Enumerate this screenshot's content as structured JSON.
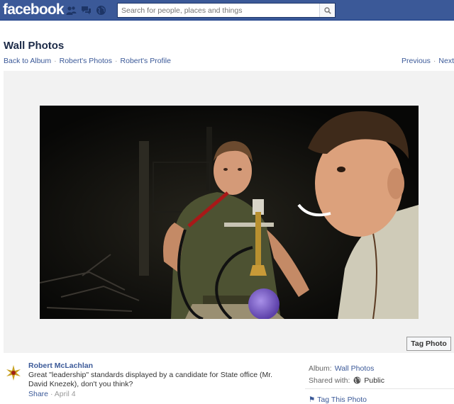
{
  "topbar": {
    "logo": "facebook",
    "jewels": [
      "friend-requests-icon",
      "messages-icon",
      "notifications-icon"
    ],
    "search_placeholder": "Search for people, places and things",
    "brand_color": "#3b5998"
  },
  "page": {
    "title": "Wall Photos",
    "breadcrumbs": [
      "Back to Album",
      "Robert's Photos",
      "Robert's Profile"
    ],
    "nav": {
      "previous": "Previous",
      "next": "Next"
    }
  },
  "photo": {
    "alt": "Two soldiers at night, one smoking a hookah",
    "tag_button": "Tag Photo"
  },
  "post": {
    "author": "Robert McLachlan",
    "message": "Great \"leadership\" standards displayed by a candidate for State office (Mr. David Knezek), don't you think?",
    "share": "Share",
    "dot": "·",
    "date": "April 4"
  },
  "sidebar": {
    "album_label": "Album:",
    "album_value": "Wall Photos",
    "shared_label": "Shared with:",
    "shared_value": "Public",
    "tag_this_photo": "Tag This Photo"
  }
}
